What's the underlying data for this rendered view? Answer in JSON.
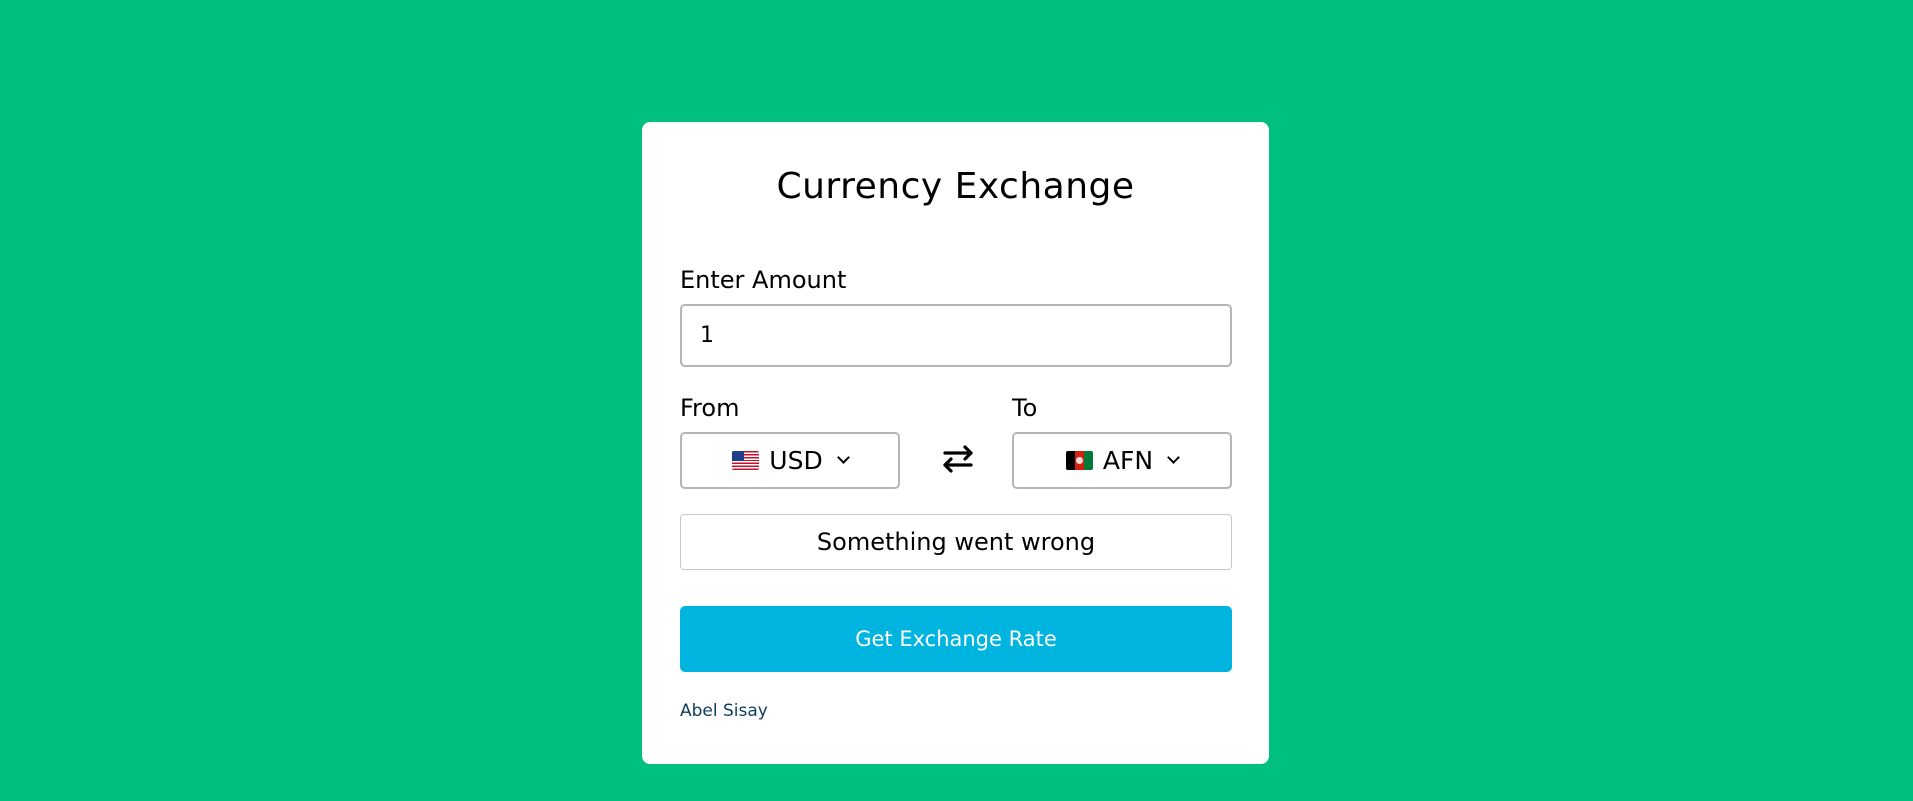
{
  "card": {
    "title": "Currency Exchange"
  },
  "amount": {
    "label": "Enter Amount",
    "value": "1"
  },
  "from": {
    "label": "From",
    "currency": "USD",
    "flag": "us-flag-icon"
  },
  "to": {
    "label": "To",
    "currency": "AFN",
    "flag": "af-flag-icon"
  },
  "swap": {
    "icon": "swap-arrows-icon"
  },
  "result": {
    "text": "Something went wrong"
  },
  "action": {
    "button_label": "Get Exchange Rate"
  },
  "footer": {
    "author": "Abel Sisay"
  },
  "colors": {
    "background": "#00c07f",
    "card": "#ffffff",
    "button": "#00b4e0",
    "author_link": "#0d3d5c"
  }
}
